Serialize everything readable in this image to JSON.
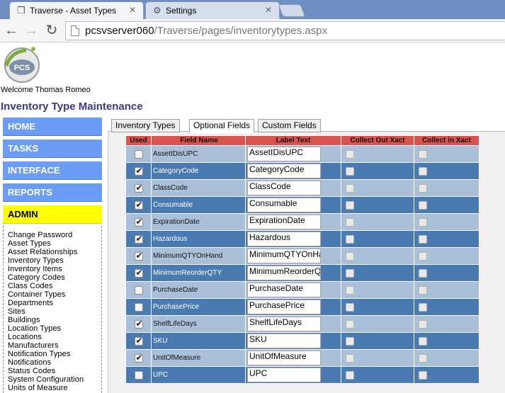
{
  "browser": {
    "tabs": [
      {
        "title": "Traverse - Asset Types",
        "icon": "page-icon",
        "active": true
      },
      {
        "title": "Settings",
        "icon": "gear-icon",
        "active": false
      }
    ],
    "url_host": "pcsvserver060",
    "url_path": "/Traverse/pages/inventorytypes.aspx"
  },
  "header": {
    "logo_text": "PCS",
    "welcome": "Welcome Thomas Romeo",
    "title": "Inventory Type Maintenance"
  },
  "sidebar": {
    "menu": [
      "HOME",
      "TASKS",
      "INTERFACE",
      "REPORTS",
      "ADMIN"
    ],
    "active": "ADMIN",
    "admin_links": [
      "Change Password",
      "Asset Types",
      "Asset Relationships",
      "Inventory Types",
      "Inventory Items",
      "Category Codes",
      "Class Codes",
      "Container Types",
      "Departments",
      "Sites",
      "Buildings",
      "Location Types",
      "Locations",
      "Manufacturers",
      "Notification Types",
      "Notifications",
      "Status Codes",
      "System Configuration",
      "Units of Measure"
    ]
  },
  "content_tabs": [
    "Inventory Types",
    "Optional Fields",
    "Custom Fields"
  ],
  "selected_tab": "Optional Fields",
  "grid": {
    "headers": [
      "Used",
      "Field Name",
      "Label Text",
      "Collect Out Xact",
      "Collect in Xact"
    ],
    "rows": [
      {
        "used": false,
        "field": "AssetIDisUPC",
        "label": "AssetIDisUPC"
      },
      {
        "used": true,
        "field": "CategoryCode",
        "label": "CategoryCode"
      },
      {
        "used": true,
        "field": "ClassCode",
        "label": "ClassCode"
      },
      {
        "used": true,
        "field": "Consumable",
        "label": "Consumable"
      },
      {
        "used": true,
        "field": "ExpirationDate",
        "label": "ExpirationDate"
      },
      {
        "used": true,
        "field": "Hazardous",
        "label": "Hazardous"
      },
      {
        "used": true,
        "field": "MinimumQTYOnHand",
        "label": "MinimumQTYOnHand"
      },
      {
        "used": true,
        "field": "MinimumReorderQTY",
        "label": "MinimumReorderQTY"
      },
      {
        "used": false,
        "field": "PurchaseDate",
        "label": "PurchaseDate"
      },
      {
        "used": false,
        "field": "PurchasePrice",
        "label": "PurchasePrice"
      },
      {
        "used": true,
        "field": "ShelfLifeDays",
        "label": "ShelfLifeDays"
      },
      {
        "used": true,
        "field": "SKU",
        "label": "SKU"
      },
      {
        "used": true,
        "field": "UnitOfMeasure",
        "label": "UnitOfMeasure"
      },
      {
        "used": false,
        "field": "UPC",
        "label": "UPC"
      }
    ]
  },
  "colors": {
    "menu_blue": "#6b9cf6",
    "menu_active": "#ffff00",
    "header_red": "#d9534f",
    "row_light": "#aac0d9",
    "row_dark": "#4a7bb0",
    "title": "#3a3a80"
  }
}
